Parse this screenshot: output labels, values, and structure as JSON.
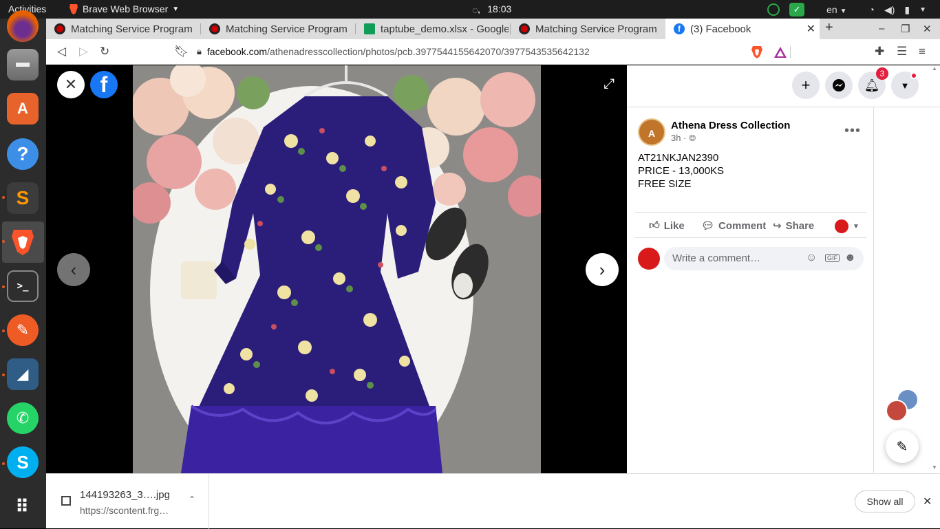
{
  "topbar": {
    "activities": "Activities",
    "app_name": "Brave Web Browser",
    "day": "ꩻ",
    "clock": "18:03",
    "lang": "en"
  },
  "tabs": [
    {
      "label": "Matching Service Program"
    },
    {
      "label": "Matching Service Program"
    },
    {
      "label": "taptube_demo.xlsx - Google"
    },
    {
      "label": "Matching Service Program"
    },
    {
      "label": "(3) Facebook"
    }
  ],
  "toolbar": {
    "url_host": "facebook.com",
    "url_path": "/athenadresscollection/photos/pcb.3977544155642070/3977543535642132"
  },
  "panel": {
    "notification_count": "3",
    "page_name": "Athena Dress Collection",
    "post_time": "3h ·",
    "post_lines": [
      "AT21NKJAN2390",
      "PRICE - 13,000KS",
      "FREE SIZE"
    ],
    "actions": {
      "like": "Like",
      "comment": "Comment",
      "share": "Share"
    },
    "comment_placeholder": "Write a comment…"
  },
  "downloads": {
    "file_name": "144193263_3….jpg",
    "file_source": "https://scontent.frg…",
    "show_all": "Show all"
  },
  "colors": {
    "fb_blue": "#1877f2",
    "brave_orange": "#fb542b",
    "dress_purple": "#2b1e7a"
  }
}
